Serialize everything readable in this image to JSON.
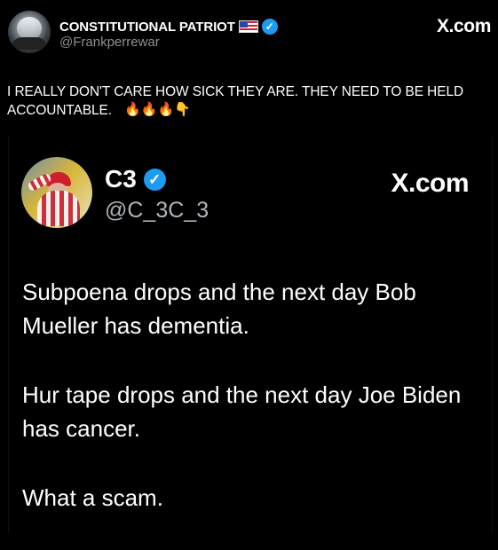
{
  "outer_post": {
    "display_name": "CONSTITUTIONAL PATRIOT",
    "flag_icon": "us-flag-icon",
    "verified_icon": "verified-badge-icon",
    "handle": "@Frankperrewar",
    "site_label": "X.com",
    "text": "I REALLY DON'T CARE HOW SICK THEY ARE. THEY NEED TO BE HELD ACCOUNTABLE.",
    "emojis": "🔥🔥🔥👇"
  },
  "quoted_post": {
    "display_name": "C3",
    "verified_icon": "verified-badge-icon",
    "handle": "@C_3C_3",
    "site_label": "X.com",
    "paragraphs": [
      "Subpoena drops and the next day Bob Mueller has dementia.",
      "Hur tape drops and the next day Joe Biden has cancer.",
      "What a scam."
    ]
  },
  "colors": {
    "background": "#000000",
    "primary_text": "#ffffff",
    "secondary_text": "#8b8f94",
    "verified_blue": "#1d9bf0"
  }
}
